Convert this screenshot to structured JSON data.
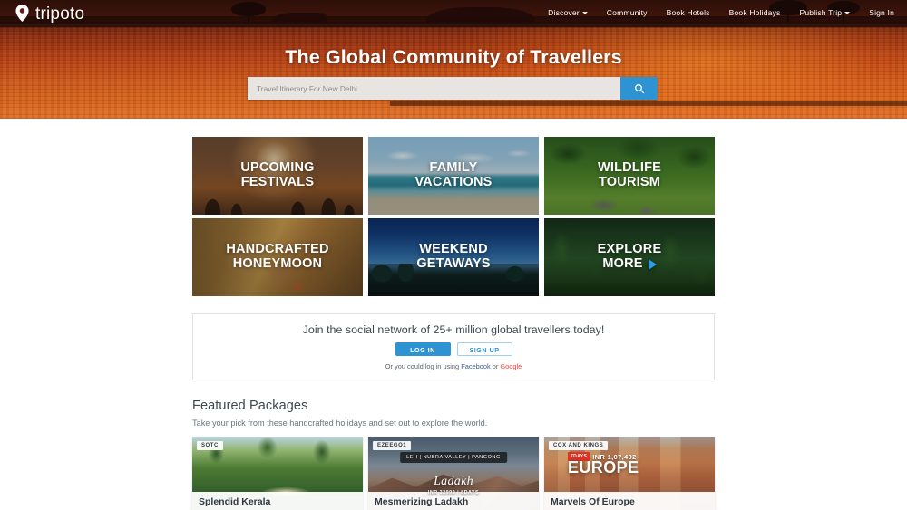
{
  "header": {
    "logo_text": "tripoto",
    "logo_icon": "map-pin-icon",
    "nav": [
      {
        "label": "Discover",
        "caret": true
      },
      {
        "label": "Community",
        "caret": false
      },
      {
        "label": "Book Hotels",
        "caret": false
      },
      {
        "label": "Book Holidays",
        "caret": false
      },
      {
        "label": "Publish Trip",
        "caret": true
      },
      {
        "label": "Sign In",
        "caret": false
      }
    ]
  },
  "hero": {
    "title": "The Global Community of Travellers",
    "search_placeholder": "Travel Itinerary For New Delhi",
    "search_value": "",
    "search_icon": "search-icon",
    "accent_color": "#2d93d3"
  },
  "categories": [
    {
      "line1": "UPCOMING",
      "line2": "FESTIVALS",
      "art": "art-festival",
      "arrow": false
    },
    {
      "line1": "FAMILY",
      "line2": "VACATIONS",
      "art": "art-family",
      "arrow": false
    },
    {
      "line1": "WILDLIFE",
      "line2": "TOURISM",
      "art": "art-wildlife",
      "arrow": false
    },
    {
      "line1": "HANDCRAFTED",
      "line2": "HONEYMOON",
      "art": "art-honeymoon",
      "arrow": false
    },
    {
      "line1": "WEEKEND",
      "line2": "GETAWAYS",
      "art": "art-weekend",
      "arrow": false
    },
    {
      "line1": "EXPLORE",
      "line2": "MORE",
      "art": "art-explore",
      "arrow": true
    }
  ],
  "join": {
    "headline": "Join the social network of 25+ million global travellers today!",
    "login_label": "LOG IN",
    "signup_label": "SIGN UP",
    "alt_prefix": "Or you could log in using ",
    "facebook_label": "Facebook",
    "alt_joiner": " or ",
    "google_label": "Google"
  },
  "featured": {
    "title": "Featured Packages",
    "subtitle": "Take your pick from these handcrafted holidays and set out to explore the world.",
    "packages": [
      {
        "badge": "SOTC",
        "title": "Splendid Kerala",
        "art": "art-kerala"
      },
      {
        "badge": "EZEEGO1",
        "title": "Mesmerizing Ladakh",
        "art": "art-ladakh",
        "route": "LEH | NUBRA VALLEY | PANGONG",
        "destination": "Ladakh",
        "price_line": "INR 32999 | 8DAYS"
      },
      {
        "badge": "COX AND KINGS",
        "title": "Marvels Of Europe",
        "art": "art-europe",
        "days_tag": "7DAYS",
        "price": "INR 1,07,402",
        "destination": "EUROPE"
      }
    ]
  }
}
